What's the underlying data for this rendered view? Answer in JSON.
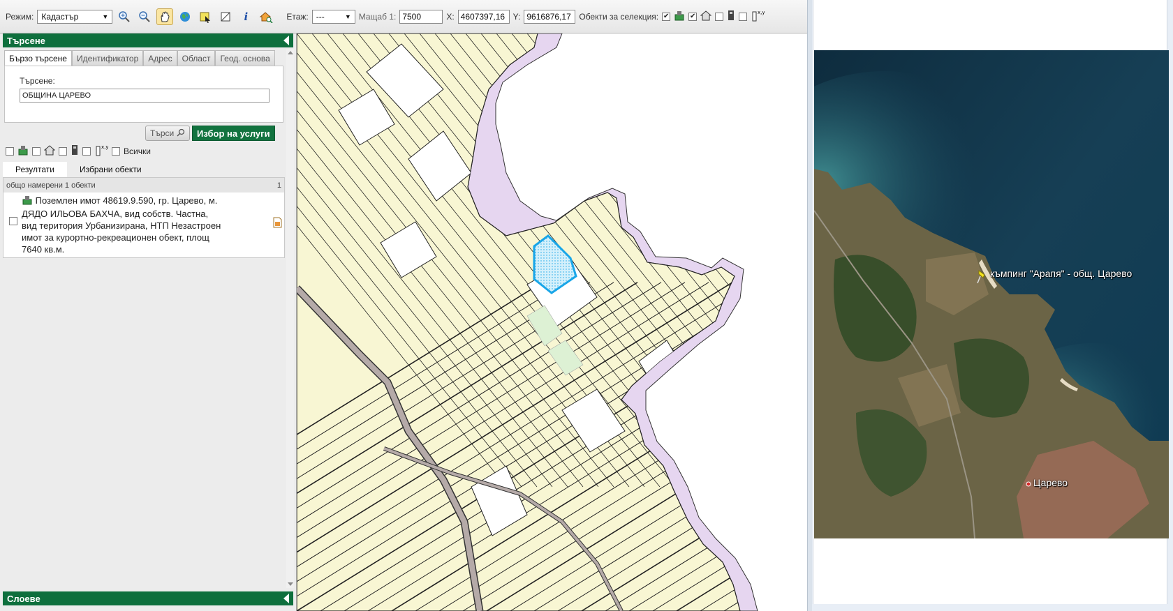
{
  "toolbar": {
    "mode_label": "Режим:",
    "mode_value": "Кадастър",
    "floor_label": "Етаж:",
    "floor_value": "---",
    "scale_label": "Мащаб 1:",
    "scale_value": "7500",
    "x_label": "X:",
    "x_value": "4607397,16",
    "y_label": "Y:",
    "y_value": "9616876,17",
    "selection_label": "Обекти за селекция:",
    "icons": [
      "zoom-in-icon",
      "zoom-out-icon",
      "pan-hand-icon",
      "globe-icon",
      "select-area-icon",
      "measure-icon",
      "info-icon",
      "home-locate-icon"
    ]
  },
  "search_panel": {
    "title": "Търсене",
    "tabs": [
      "Бързо търсене",
      "Идентификатор",
      "Адрес",
      "Област",
      "Геод. основа"
    ],
    "active_tab": 0,
    "field_label": "Търсене:",
    "field_value": "ОБЩИНА ЦАРЕВО",
    "search_button": "Търси",
    "services_button": "Избор на услуги",
    "all_label": "Всички"
  },
  "results": {
    "tabs": [
      "Резултати",
      "Избрани обекти"
    ],
    "summary": "общо намерени 1 обекти",
    "page": "1",
    "item_lines": [
      "Поземлен имот 48619.9.590, гр. Царево, м.",
      "ДЯДО ИЛЬОВА БАХЧА, вид собств. Частна,",
      "вид територия Урбанизирана, НТП Незастроен",
      "имот за курортно-рекреационен обект, площ",
      "7640 кв.м."
    ]
  },
  "layers_panel": {
    "title": "Слоеве"
  },
  "satellite": {
    "placemark_label": "къмпинг \"Арапя\" - общ. Царево",
    "town_label": "Царево"
  },
  "colors": {
    "brand_green": "#0e6f3d",
    "parcel_fill": "#f8f6d3",
    "sea_zone": "#e6d6f0",
    "road": "#b5aaa8",
    "highlight": "#19a6e8",
    "green_parcel": "#ddf1d4"
  }
}
